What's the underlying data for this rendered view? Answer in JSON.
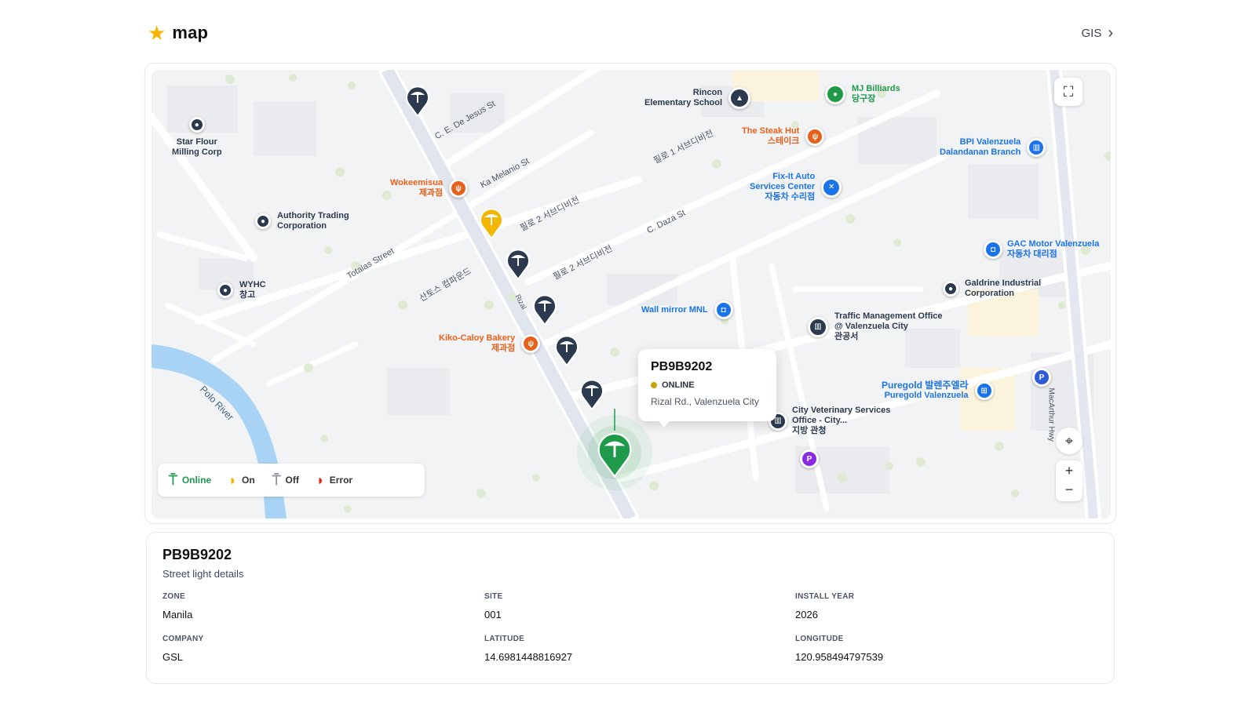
{
  "header": {
    "title": "map",
    "gis_link": "GIS"
  },
  "roads": {
    "de_jesus": "C. E. De Jesus St",
    "melanio": "Ka Melanio St",
    "phil1": "필로 1 서브디비전",
    "phil2a": "필로 2 서브디비전",
    "phil2b": "필로 2 서브디비전",
    "daza": "C. Daza St",
    "totalas": "Totalas Street",
    "santos": "산토스 컴파운드",
    "rizal": "Rizal",
    "macarthur": "MacArthur Hwy",
    "river": "Polo River"
  },
  "pois": {
    "star_flour": [
      "Star Flour",
      "Milling Corp"
    ],
    "authority": [
      "Authority Trading",
      "Corporation"
    ],
    "wyhc": [
      "WYHC",
      "창고"
    ],
    "rincon": [
      "Rincon",
      "Elementary School"
    ],
    "mj": [
      "MJ Billiards",
      "당구장"
    ],
    "steak": [
      "The Steak Hut",
      "스테이크"
    ],
    "wokeemisua": [
      "Wokeemisua",
      "제과점"
    ],
    "fixit": [
      "Fix-It Auto",
      "Services Center",
      "자동차 수리점"
    ],
    "bpi": [
      "BPI Valenzuela",
      "Dalandanan Branch"
    ],
    "gac": [
      "GAC Motor Valenzuela",
      "자동차 대리점"
    ],
    "galdrine": [
      "Galdrine Industrial",
      "Corporation"
    ],
    "wall_mirror": [
      "Wall mirror MNL"
    ],
    "traffic": [
      "Traffic Management Office",
      "@ Valenzuela City",
      "관공서"
    ],
    "kiko": [
      "Kiko-Caloy Bakery",
      "제과점"
    ],
    "vet": [
      "City Veterinary Services",
      "Office - City...",
      "지방 관청"
    ],
    "puregold": [
      "Puregold 발렌주엘라",
      "Puregold Valenzuela"
    ],
    "parking": "P"
  },
  "popup": {
    "id": "PB9B9202",
    "status": "ONLINE",
    "address": "Rizal Rd., Valenzuela City"
  },
  "legend": {
    "online": "Online",
    "on": "On",
    "off": "Off",
    "error": "Error"
  },
  "controls": {
    "zoom_in": "+",
    "zoom_out": "−"
  },
  "details": {
    "id": "PB9B9202",
    "subtitle": "Street light details",
    "zone_label": "ZONE",
    "zone": "Manila",
    "site_label": "SITE",
    "site": "001",
    "install_year_label": "INSTALL YEAR",
    "install_year": "2026",
    "company_label": "COMPANY",
    "company": "GSL",
    "latitude_label": "LATITUDE",
    "latitude": "14.6981448816927",
    "longitude_label": "LONGITUDE",
    "longitude": "120.958494797539"
  },
  "colors": {
    "online": "#1f9a4a",
    "on": "#f2b705",
    "off": "#8a8f98",
    "error": "#d92d20",
    "pin_navy": "#2c3a4f",
    "food": "#e8611a",
    "blue_poi": "#1a73e8",
    "purple": "#8a2be2"
  },
  "icons": [
    "star-icon",
    "chevron-right-icon",
    "fullscreen-icon",
    "locate-icon",
    "streetlight-icon",
    "fork-knife-icon",
    "school-icon",
    "bank-icon",
    "cart-icon",
    "car-repair-icon",
    "bag-icon",
    "government-icon"
  ]
}
